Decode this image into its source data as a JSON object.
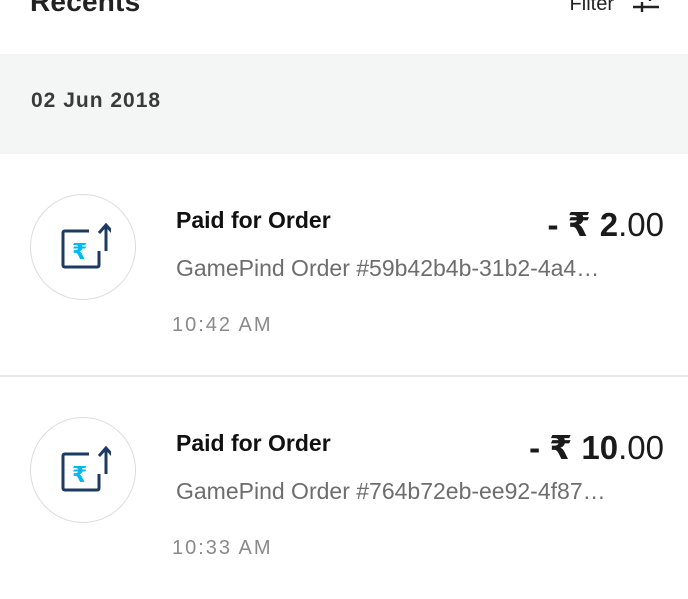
{
  "header": {
    "title": "Recents",
    "filter_label": "Filter",
    "filter_icon": "sliders-icon"
  },
  "date_group": "02 Jun 2018",
  "transactions": [
    {
      "title": "Paid for Order",
      "amount_sign": "- ₹ ",
      "amount_major": "2",
      "amount_minor": ".00",
      "description": "GamePind Order #59b42b4b-31b2-4a4…",
      "time": "10:42 AM",
      "icon": "rupee-send-icon"
    },
    {
      "title": "Paid for Order",
      "amount_sign": "- ₹ ",
      "amount_major": "10",
      "amount_minor": ".00",
      "description": "GamePind Order #764b72eb-ee92-4f87…",
      "time": "10:33 AM",
      "icon": "rupee-send-icon"
    }
  ],
  "colors": {
    "icon_dark": "#1d3a63",
    "icon_accent": "#00b9f1",
    "date_bar_bg": "#f4f6f6"
  }
}
